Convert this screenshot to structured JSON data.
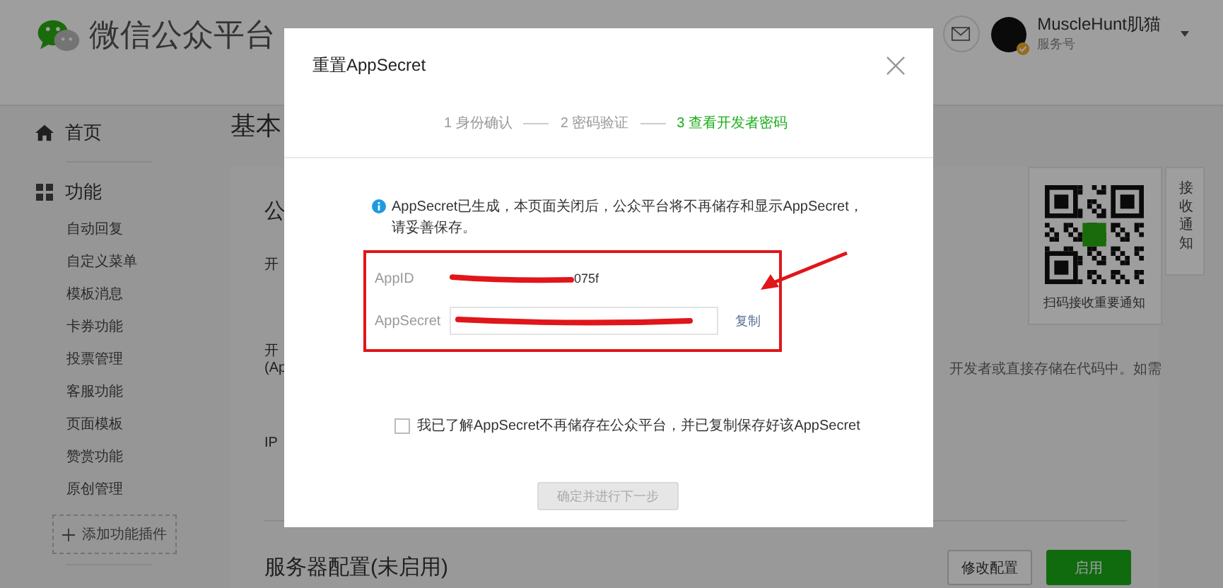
{
  "header": {
    "title": "微信公众平台",
    "account_name": "MuscleHunt肌猫",
    "account_type": "服务号"
  },
  "sidebar": {
    "home": "首页",
    "section_title": "功能",
    "items": [
      "自动回复",
      "自定义菜单",
      "模板消息",
      "卡券功能",
      "投票管理",
      "客服功能",
      "页面模板",
      "赞赏功能",
      "原创管理"
    ],
    "add_plugin": "添加功能插件"
  },
  "content": {
    "page_title": "基本",
    "panel_texts": [
      {
        "text": "公",
        "kind": "heading"
      },
      {
        "text": "开",
        "kind": "label"
      },
      {
        "text": "开",
        "kind": "label"
      },
      {
        "text": "(Ap",
        "kind": "label"
      },
      {
        "text": "IP",
        "kind": "label"
      }
    ],
    "right_text": "开发者或直接存储在代码中。如需",
    "server_title": "服务器配置(未启用)",
    "buttons": [
      {
        "label": "修改配置",
        "kind": "secondary"
      },
      {
        "label": "启用",
        "kind": "primary"
      }
    ]
  },
  "qr_card": {
    "caption": "扫码接收重要通知"
  },
  "side_tab": {
    "label": "接收通知"
  },
  "dialog": {
    "title": "重置AppSecret",
    "steps": [
      {
        "label": "1 身份确认",
        "selected": false
      },
      {
        "label": "2 密码验证",
        "selected": false
      },
      {
        "label": "3 查看开发者密码",
        "selected": true
      }
    ],
    "notice": "AppSecret已生成，本页面关闭后，公众平台将不再储存和显示AppSecret，请妥善保存。",
    "appid": {
      "label": "AppID",
      "value": "075f"
    },
    "appsecret": {
      "label": "AppSecret"
    },
    "copy_link": "复制",
    "agreement": {
      "label": "我已了解AppSecret不再储存在公众平台，并已复制保存好该AppSecret",
      "checked": false
    },
    "next_button": {
      "label": "确定并进行下一步",
      "disabled": true
    }
  }
}
